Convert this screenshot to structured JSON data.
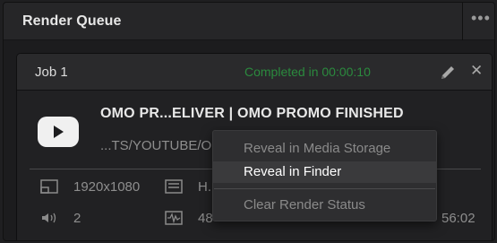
{
  "header": {
    "title": "Render Queue",
    "more_icon": "more-horizontal-icon"
  },
  "job": {
    "title": "Job 1",
    "status": "Completed in 00:00:10",
    "status_color": "#2b8a3e",
    "edit_icon": "pencil-icon",
    "close_icon": "close-icon",
    "platform_icon": "youtube-icon",
    "output_name": "OMO PR...ELIVER | OMO PROMO FINISHED",
    "output_path_visible": "...TS/YOUTUBE/O",
    "resolution": "1920x1080",
    "codec_partial": "H.",
    "audio_channels": "2",
    "bitrate_partial": "48",
    "duration_partial": "56:02"
  },
  "context_menu": {
    "items": [
      {
        "label": "Reveal in Media Storage",
        "state": "disabled"
      },
      {
        "label": "Reveal in Finder",
        "state": "highlighted"
      },
      {
        "label": "Clear Render Status",
        "state": "disabled"
      }
    ]
  }
}
